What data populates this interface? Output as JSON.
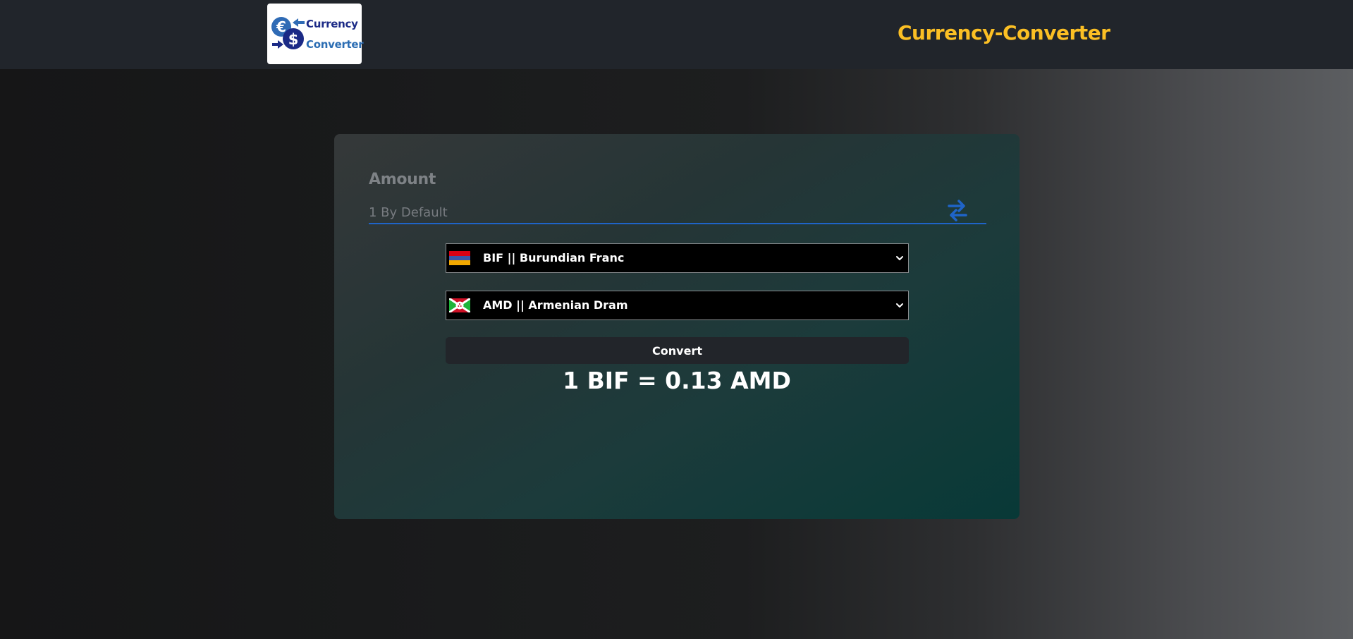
{
  "header": {
    "logo": {
      "line1": "Currency",
      "line2": "Converter",
      "icon": "euro-dollar-exchange-icon"
    },
    "brand_title": "Currency-Converter",
    "brand_color": "#fbbf24"
  },
  "converter": {
    "amount_label": "Amount",
    "amount_value": "",
    "amount_placeholder": "1 By Default",
    "swap_icon": "swap-arrows-icon",
    "from": {
      "text": "BIF || Burundian Franc",
      "flag": "armenia-flag"
    },
    "to": {
      "text": "AMD || Armenian Dram",
      "flag": "burundi-flag"
    },
    "convert_label": "Convert",
    "result": "1 BIF = 0.13 AMD",
    "accent_color": "#1f64c8"
  }
}
